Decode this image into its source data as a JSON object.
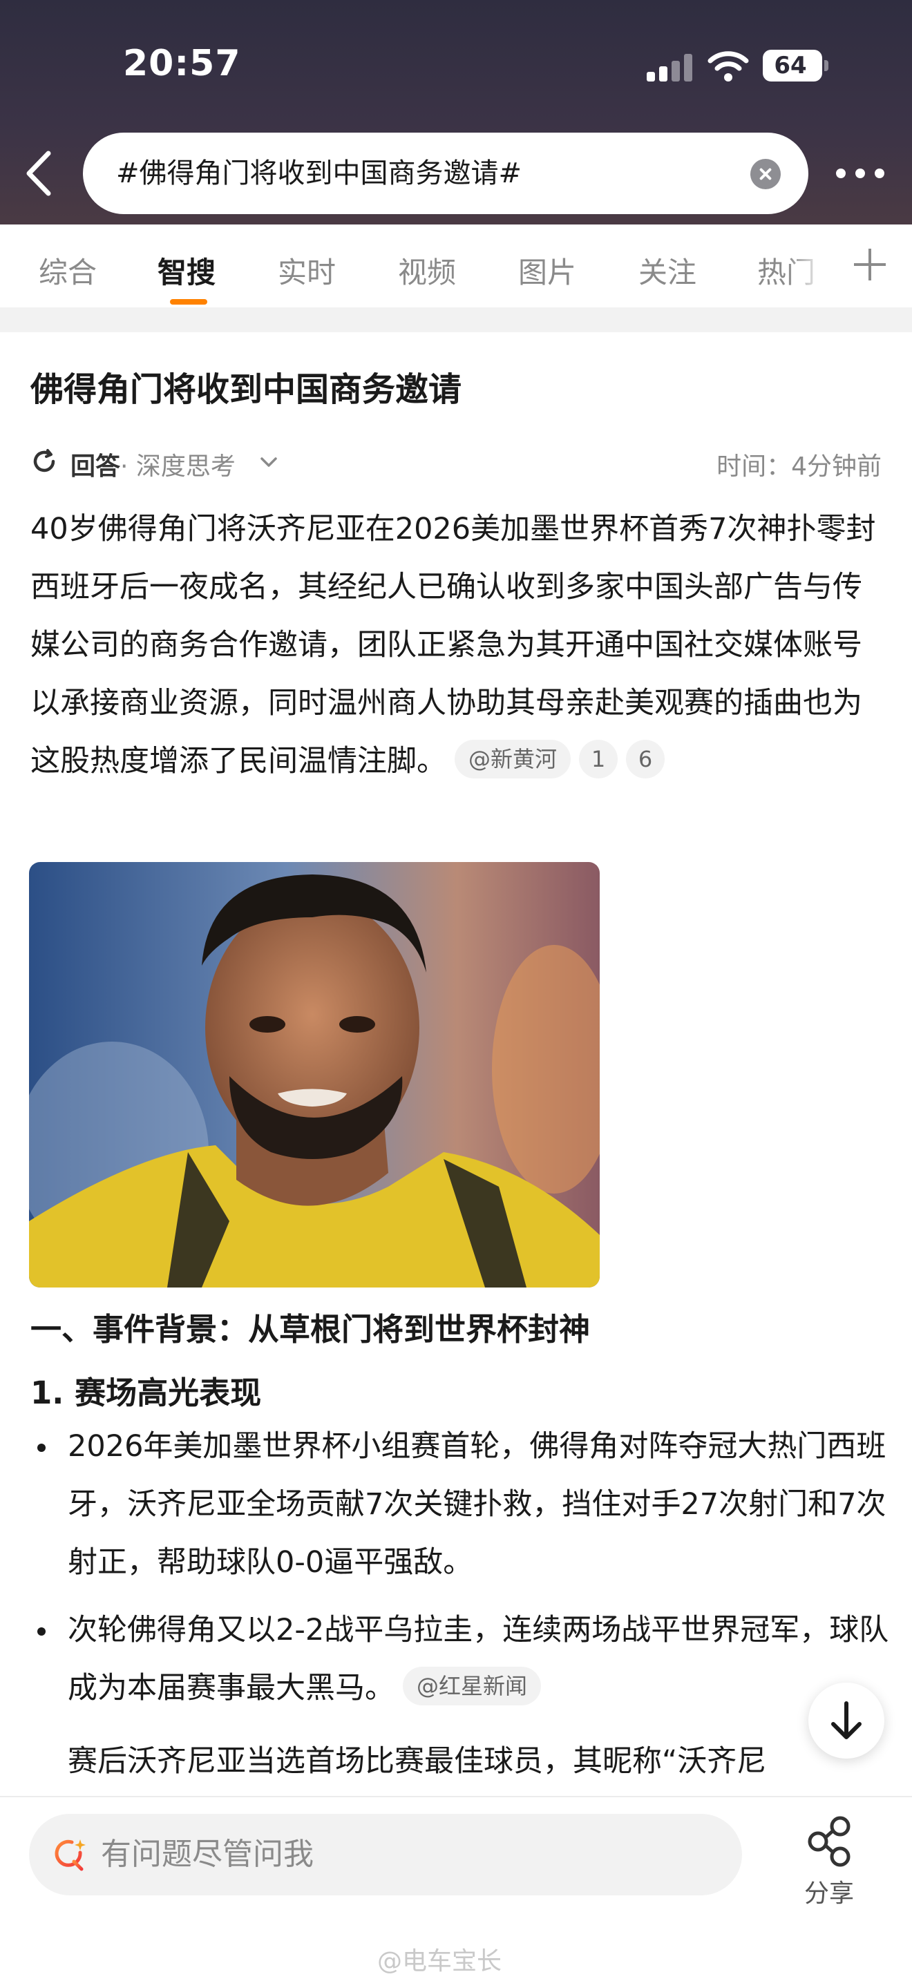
{
  "status_bar": {
    "time": "20:57",
    "battery": "64"
  },
  "search": {
    "query": "#佛得角门将收到中国商务邀请#"
  },
  "tabs": [
    {
      "label": "综合"
    },
    {
      "label": "智搜"
    },
    {
      "label": "实时"
    },
    {
      "label": "视频"
    },
    {
      "label": "图片"
    },
    {
      "label": "关注"
    },
    {
      "label": "热门"
    }
  ],
  "article": {
    "title": "佛得角门将收到中国商务邀请",
    "answer_label": "回答",
    "depth_label": "· 深度思考",
    "time_label": "时间：4分钟前",
    "intro": "40岁佛得角门将沃齐尼亚在2026美加墨世界杯首秀7次神扑零封西班牙后一夜成名，其经纪人已确认收到多家中国头部广告与传媒公司的商务合作邀请，团队正紧急为其开通中国社交媒体账号以承接商业资源，同时温州商人协助其母亲赴美观赛的插曲也为这股热度增添了民间温情注脚。",
    "intro_source": "@新黄河",
    "intro_ref1": "1",
    "intro_ref2": "6",
    "section_heading": "一、事件背景：从草根门将到世界杯封神",
    "subheading": "1. 赛场高光表现",
    "bullets": [
      {
        "text": "2026年美加墨世界杯小组赛首轮，佛得角对阵夺冠大热门西班牙，沃齐尼亚全场贡献7次关键扑救，挡住对手27次射门和7次射正，帮助球队0-0逼平强敌。"
      },
      {
        "text": "次轮佛得角又以2-2战平乌拉圭，连续两场战平世界冠军，球队成为本届赛事最大黑马。",
        "source": "@红星新闻"
      },
      {
        "text": "赛后沃齐尼亚当选首场比赛最佳球员，其昵称“沃齐尼"
      }
    ]
  },
  "bottom_bar": {
    "ask_placeholder": "有问题尽管问我",
    "share_label": "分享"
  },
  "watermark": "@电车宝长",
  "colors": {
    "accent": "#ff8200",
    "header_bg": "#3b3346"
  }
}
